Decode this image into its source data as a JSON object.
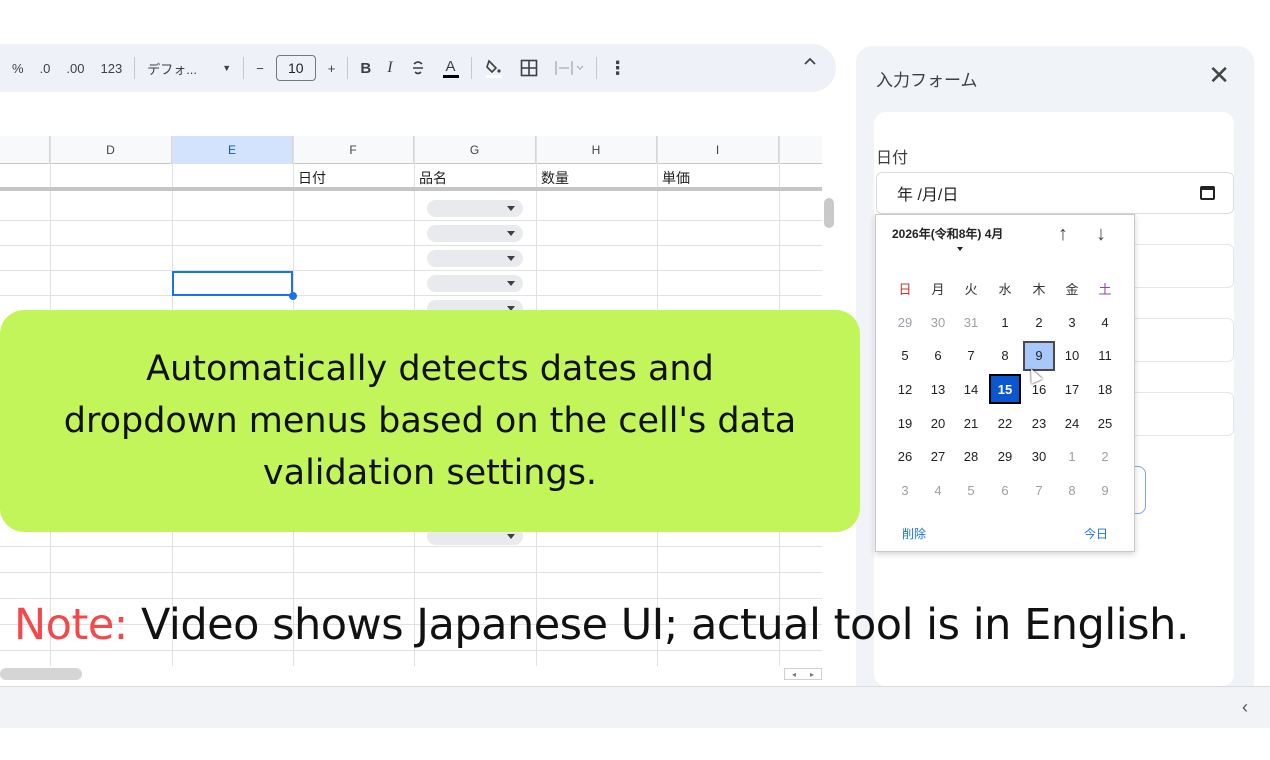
{
  "toolbar": {
    "percent": "%",
    "decrease_decimal": ".0",
    "increase_decimal": ".00",
    "number_format": "123",
    "font_name": "デフォ...",
    "minus": "−",
    "font_size": "10",
    "plus": "+",
    "bold": "B",
    "italic": "I",
    "text_color": "A"
  },
  "sheet": {
    "columns": [
      "D",
      "E",
      "F",
      "G",
      "H",
      "I"
    ],
    "selected_column": "E",
    "header_cells": [
      "日付",
      "品名",
      "数量",
      "単価"
    ]
  },
  "panel": {
    "title": "入力フォーム",
    "close": "✕",
    "field_label": "日付",
    "date_placeholder": "年 /月/日"
  },
  "calendar": {
    "month_label": "2026年(令和8年) 4月",
    "up": "↑",
    "down": "↓",
    "weekdays": [
      "日",
      "月",
      "火",
      "水",
      "木",
      "金",
      "土"
    ],
    "weeks": [
      [
        "29",
        "30",
        "31",
        "1",
        "2",
        "3",
        "4"
      ],
      [
        "5",
        "6",
        "7",
        "8",
        "9",
        "10",
        "11"
      ],
      [
        "12",
        "13",
        "14",
        "15",
        "16",
        "17",
        "18"
      ],
      [
        "19",
        "20",
        "21",
        "22",
        "23",
        "24",
        "25"
      ],
      [
        "26",
        "27",
        "28",
        "29",
        "30",
        "1",
        "2"
      ],
      [
        "3",
        "4",
        "5",
        "6",
        "7",
        "8",
        "9"
      ]
    ],
    "selected_day": "15",
    "hovered_day": "9",
    "clear": "削除",
    "today": "今日"
  },
  "callout": {
    "text": "Automatically detects dates and dropdown menus based on the cell's data validation settings."
  },
  "note": {
    "label": "Note:",
    "text": " Video shows Japanese UI; actual tool is in English."
  },
  "colors": {
    "callout_bg": "#c2f55a",
    "note_label": "#f4494b",
    "selection_blue": "#0b57d0",
    "panel_bg": "#f0f4f9"
  }
}
